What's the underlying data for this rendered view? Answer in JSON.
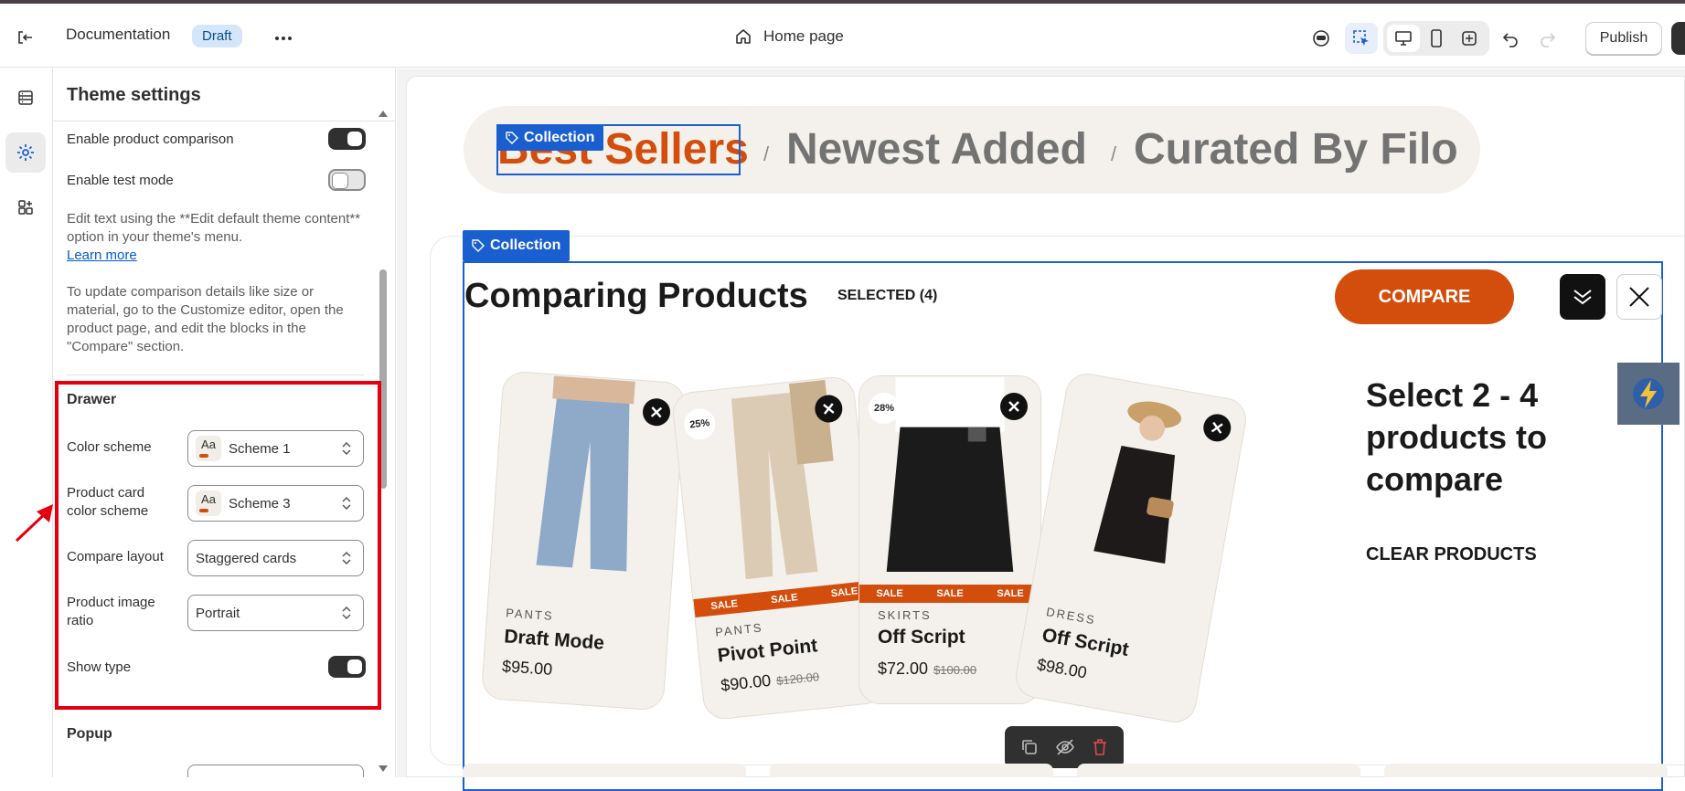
{
  "topbar": {
    "store_title": "Documentation",
    "status_badge": "Draft",
    "page_name": "Home page",
    "publish_label": "Publish"
  },
  "panel": {
    "title": "Theme settings",
    "rows": {
      "enable_comparison": "Enable product comparison",
      "enable_test_mode": "Enable test mode"
    },
    "help1": "Edit text using the **Edit default theme content** option in your theme's menu.",
    "learn_more": "Learn more",
    "help2": "To update comparison details like size or material, go to the Customize editor, open the product page, and edit the blocks in the \"Compare\" section.",
    "drawer": {
      "heading": "Drawer",
      "color_scheme_label": "Color scheme",
      "color_scheme_value": "Scheme 1",
      "card_scheme_label": "Product card color scheme",
      "card_scheme_value": "Scheme 3",
      "layout_label": "Compare layout",
      "layout_value": "Staggered cards",
      "ratio_label": "Product image ratio",
      "ratio_value": "Portrait",
      "show_type_label": "Show type",
      "swatch_text": "Aa"
    },
    "popup_heading": "Popup"
  },
  "canvas": {
    "tabs": [
      "Best Sellers",
      "Newest Added",
      "Curated By Filo"
    ],
    "tab_sep": "/",
    "collection_tag": "Collection",
    "compare_title": "Comparing Products",
    "selected": "SELECTED (4)",
    "compare_button": "COMPARE",
    "cta": "Select 2 - 4 products to compare",
    "clear": "CLEAR PRODUCTS",
    "sale_text": "SALE",
    "products": [
      {
        "type": "PANTS",
        "name": "Draft Mode",
        "price": "$95.00",
        "old": "",
        "discount": ""
      },
      {
        "type": "PANTS",
        "name": "Pivot Point",
        "price": "$90.00",
        "old": "$120.00",
        "discount": "25%"
      },
      {
        "type": "SKIRTS",
        "name": "Off Script",
        "price": "$72.00",
        "old": "$100.00",
        "discount": "28%"
      },
      {
        "type": "DRESS",
        "name": "Off Script",
        "price": "$98.00",
        "old": "",
        "discount": ""
      }
    ]
  },
  "colors": {
    "accent": "#d34e0c",
    "selection_blue": "#1a5fd0",
    "highlight_red": "#e5000f"
  }
}
